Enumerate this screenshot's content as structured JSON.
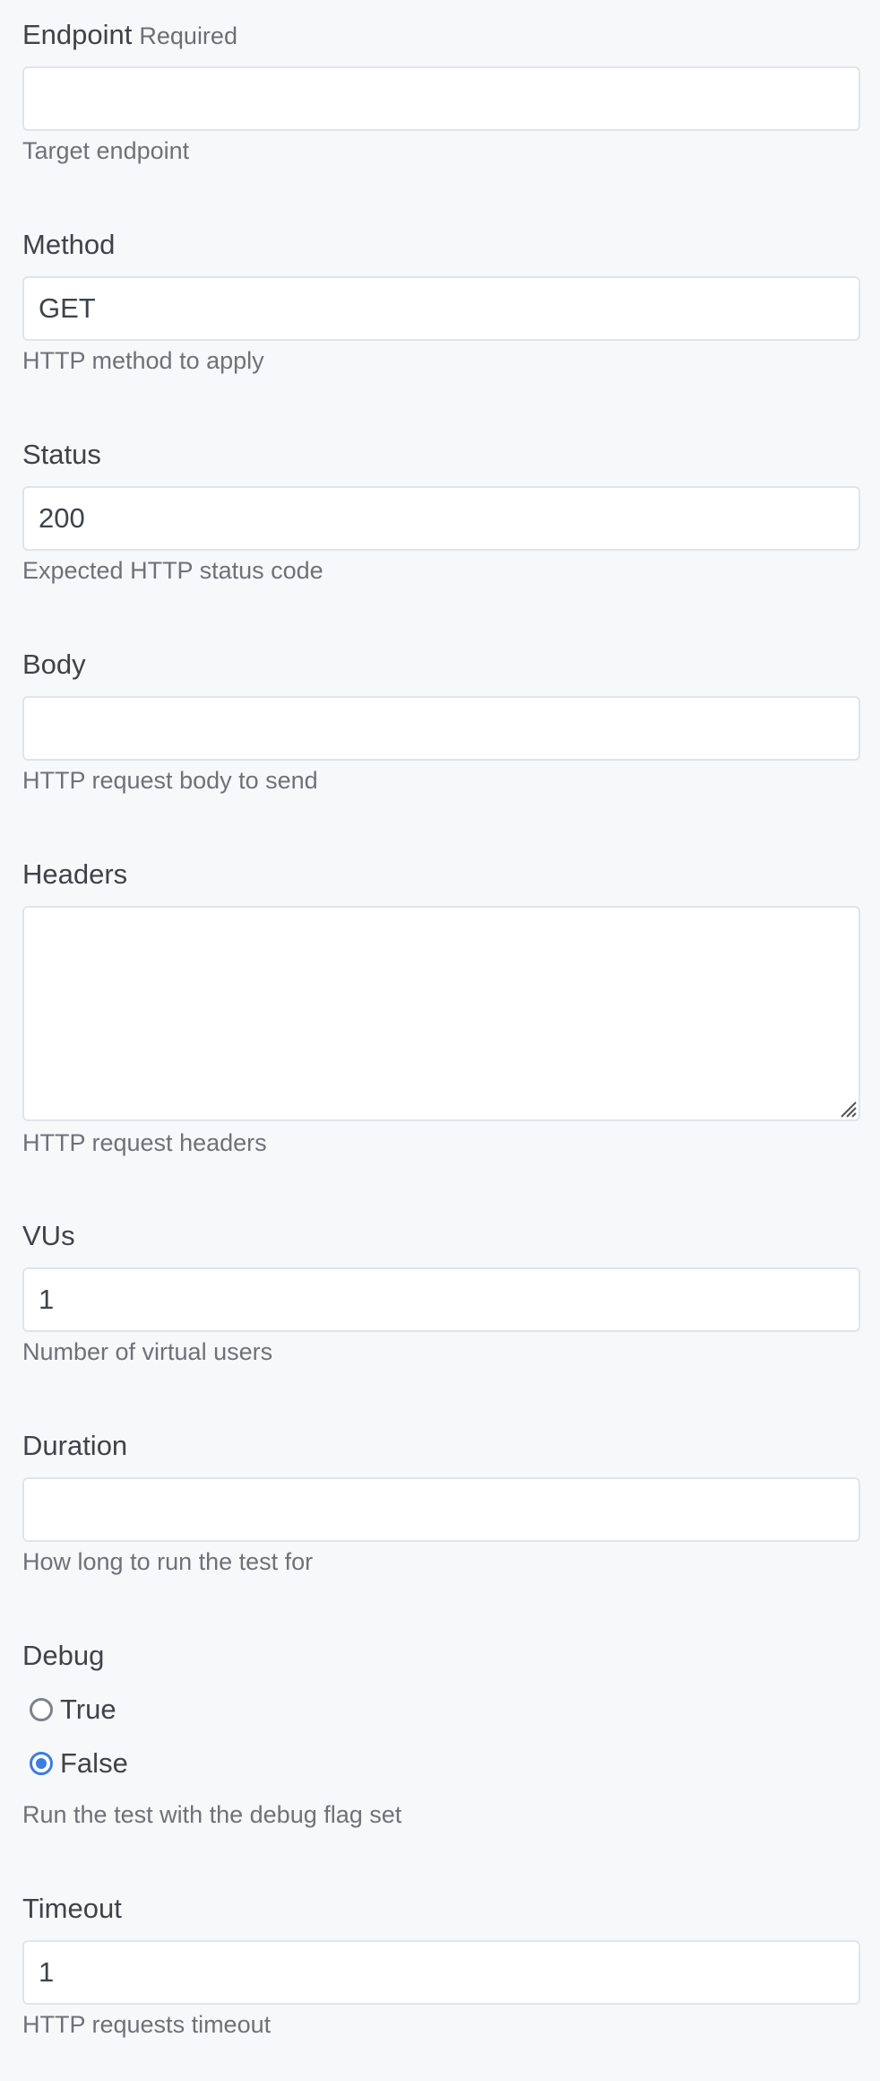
{
  "fields": {
    "endpoint": {
      "label": "Endpoint",
      "required_label": "Required",
      "value": "",
      "help": "Target endpoint"
    },
    "method": {
      "label": "Method",
      "value": "GET",
      "help": "HTTP method to apply"
    },
    "status": {
      "label": "Status",
      "value": "200",
      "help": "Expected HTTP status code"
    },
    "body": {
      "label": "Body",
      "value": "",
      "help": "HTTP request body to send"
    },
    "headers": {
      "label": "Headers",
      "value": "",
      "help": "HTTP request headers"
    },
    "vus": {
      "label": "VUs",
      "value": "1",
      "help": "Number of virtual users"
    },
    "duration": {
      "label": "Duration",
      "value": "",
      "help": "How long to run the test for"
    },
    "debug": {
      "label": "Debug",
      "options": [
        {
          "label": "True",
          "checked": false
        },
        {
          "label": "False",
          "checked": true
        }
      ],
      "help": "Run the test with the debug flag set"
    },
    "timeout": {
      "label": "Timeout",
      "value": "1",
      "help": "HTTP requests timeout"
    }
  },
  "colors": {
    "background": "#f7f8fa",
    "accent": "#3b7de0"
  }
}
